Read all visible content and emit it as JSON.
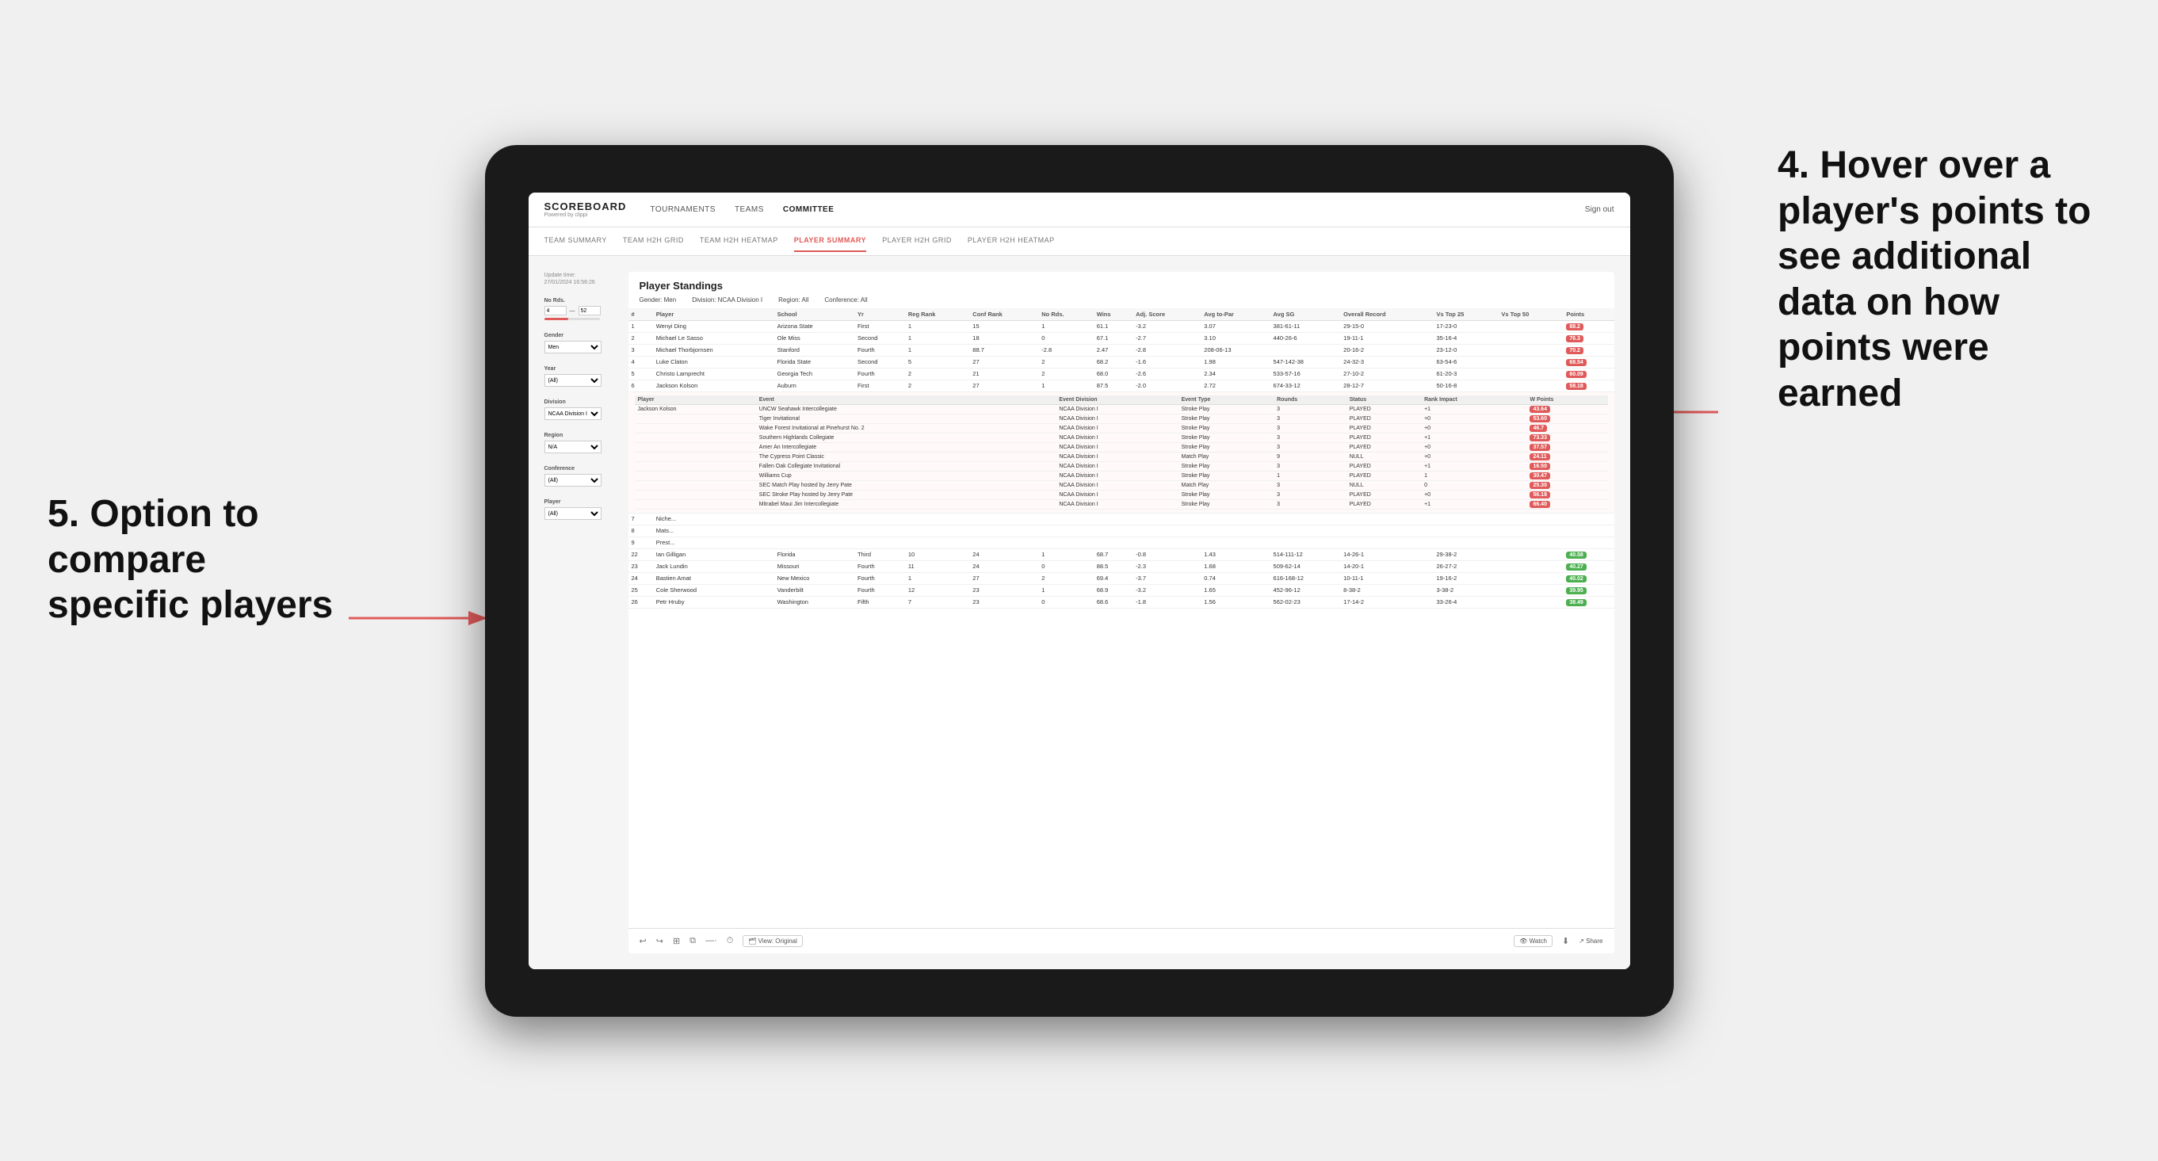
{
  "annotations": {
    "four": {
      "title": "4. Hover over a player's points to see additional data on how points were earned"
    },
    "five": {
      "title": "5. Option to compare specific players"
    }
  },
  "nav": {
    "logo": "SCOREBOARD",
    "logo_sub": "Powered by clippi",
    "links": [
      "TOURNAMENTS",
      "TEAMS",
      "COMMITTEE"
    ],
    "sign_out": "Sign out"
  },
  "sub_nav": {
    "links": [
      "TEAM SUMMARY",
      "TEAM H2H GRID",
      "TEAM H2H HEATMAP",
      "PLAYER SUMMARY",
      "PLAYER H2H GRID",
      "PLAYER H2H HEATMAP"
    ],
    "active": "PLAYER SUMMARY"
  },
  "table": {
    "title": "Player Standings",
    "update_time": "Update time:",
    "update_date": "27/01/2024 16:56:26",
    "filters": {
      "gender": "Gender: Men",
      "division": "Division: NCAA Division I",
      "region": "Region: All",
      "conference": "Conference: All"
    },
    "columns": [
      "#",
      "Player",
      "School",
      "Yr",
      "Reg Rank",
      "Conf Rank",
      "No Rds.",
      "Wins",
      "Adj. Score",
      "Avg to-Par",
      "Avg SG",
      "Overall Record",
      "Vs Top 25",
      "Vs Top 50",
      "Points"
    ],
    "rows": [
      {
        "rank": 1,
        "player": "Wenyi Ding",
        "school": "Arizona State",
        "yr": "First",
        "reg_rank": 1,
        "conf_rank": 15,
        "rds": 1,
        "wins": 61.1,
        "adj_score": -3.2,
        "avg_par": 3.07,
        "avg_sg": "381-61-11",
        "overall": "29-15-0",
        "vs25": "17-23-0",
        "vs50": "",
        "points": "88.2",
        "points_color": "red"
      },
      {
        "rank": 2,
        "player": "Michael Le Sasso",
        "school": "Ole Miss",
        "yr": "Second",
        "reg_rank": 1,
        "conf_rank": 18,
        "rds": 0,
        "wins": 67.1,
        "adj_score": -2.7,
        "avg_par": 3.1,
        "avg_sg": "440-26-6",
        "overall": "19-11-1",
        "vs25": "35-16-4",
        "vs50": "",
        "points": "76.3",
        "points_color": "red"
      },
      {
        "rank": 3,
        "player": "Michael Thorbjornsen",
        "school": "Stanford",
        "yr": "Fourth",
        "reg_rank": 1,
        "conf_rank": 88.7,
        "rds": -2.8,
        "wins": 2.47,
        "adj_score": -2.8,
        "avg_par": "208-06-13",
        "avg_sg": "",
        "overall": "20-16-2",
        "vs25": "23-12-0",
        "vs50": "",
        "points": "70.2",
        "points_color": "red"
      },
      {
        "rank": 4,
        "player": "Luke Claton",
        "school": "Florida State",
        "yr": "Second",
        "reg_rank": 5,
        "conf_rank": 27,
        "rds": 2,
        "wins": 68.2,
        "adj_score": -1.6,
        "avg_par": 1.98,
        "avg_sg": "547-142-38",
        "overall": "24-32-3",
        "vs25": "63-54-6",
        "vs50": "",
        "points": "68.54",
        "points_color": "red"
      },
      {
        "rank": 5,
        "player": "Christo Lamprecht",
        "school": "Georgia Tech",
        "yr": "Fourth",
        "reg_rank": 2,
        "conf_rank": 21,
        "rds": 2,
        "wins": 68.0,
        "adj_score": -2.6,
        "avg_par": 2.34,
        "avg_sg": "533-57-16",
        "overall": "27-10-2",
        "vs25": "61-20-3",
        "vs50": "",
        "points": "60.09",
        "points_color": "red"
      },
      {
        "rank": 6,
        "player": "Jackson Kolson",
        "school": "Auburn",
        "yr": "First",
        "reg_rank": 2,
        "conf_rank": 27,
        "rds": 1,
        "wins": 87.5,
        "adj_score": -2.0,
        "avg_par": 2.72,
        "avg_sg": "674-33-12",
        "overall": "28-12-7",
        "vs25": "50-16-8",
        "vs50": "",
        "points": "58.18",
        "points_color": "red"
      }
    ],
    "expanded_player": "Jackson Kolson",
    "expanded_rows": [
      {
        "event": "UNCW Seahawk Intercollegiate",
        "division": "NCAA Division I",
        "type": "Stroke Play",
        "rounds": 3,
        "status": "PLAYED",
        "rank_impact": "+1",
        "w_points": "43.64"
      },
      {
        "event": "Tiger Invitational",
        "division": "NCAA Division I",
        "type": "Stroke Play",
        "rounds": 3,
        "status": "PLAYED",
        "rank_impact": "+0",
        "w_points": "53.60"
      },
      {
        "event": "Wake Forest Invitational at Pinehurst No. 2",
        "division": "NCAA Division I",
        "type": "Stroke Play",
        "rounds": 3,
        "status": "PLAYED",
        "rank_impact": "+0",
        "w_points": "46.7"
      },
      {
        "event": "Southern Highlands Collegiate",
        "division": "NCAA Division I",
        "type": "Stroke Play",
        "rounds": 3,
        "status": "PLAYED",
        "rank_impact": "+1",
        "w_points": "73.33"
      },
      {
        "event": "Amer An Intercollegiate",
        "division": "NCAA Division I",
        "type": "Stroke Play",
        "rounds": 3,
        "status": "PLAYED",
        "rank_impact": "+0",
        "w_points": "37.57"
      },
      {
        "event": "The Cypress Point Classic",
        "division": "NCAA Division I",
        "type": "Match Play",
        "rounds": 9,
        "status": "NULL",
        "rank_impact": "+0",
        "w_points": "24.11"
      },
      {
        "event": "Fallen Oak Collegiate Invitational",
        "division": "NCAA Division I",
        "type": "Stroke Play",
        "rounds": 3,
        "status": "PLAYED",
        "rank_impact": "+1",
        "w_points": "16.50"
      },
      {
        "event": "Williams Cup",
        "division": "NCAA Division I",
        "type": "Stroke Play",
        "rounds": 1,
        "status": "PLAYED",
        "rank_impact": "1",
        "w_points": "30.47"
      },
      {
        "event": "SEC Match Play hosted by Jerry Pate",
        "division": "NCAA Division I",
        "type": "Match Play",
        "rounds": 3,
        "status": "NULL",
        "rank_impact": "0",
        "w_points": "25.30"
      },
      {
        "event": "SEC Stroke Play hosted by Jerry Pate",
        "division": "NCAA Division I",
        "type": "Stroke Play",
        "rounds": 3,
        "status": "PLAYED",
        "rank_impact": "+0",
        "w_points": "56.18"
      },
      {
        "event": "Mitrabel Maui Jim Intercollegiate",
        "division": "NCAA Division I",
        "type": "Stroke Play",
        "rounds": 3,
        "status": "PLAYED",
        "rank_impact": "+1",
        "w_points": "66.40"
      }
    ],
    "more_rows": [
      {
        "rank": 22,
        "player": "Ian Gilligan",
        "school": "Florida",
        "yr": "Third",
        "reg_rank": 10,
        "conf_rank": 24,
        "rds": 1,
        "wins": 68.7,
        "adj_score": -0.8,
        "avg_par": 1.43,
        "avg_sg": "514-111-12",
        "overall": "14-26-1",
        "vs25": "29-38-2",
        "vs50": "",
        "points": "40.58",
        "points_color": "green"
      },
      {
        "rank": 23,
        "player": "Jack Lundin",
        "school": "Missouri",
        "yr": "Fourth",
        "reg_rank": 11,
        "conf_rank": 24,
        "rds": 0,
        "wins": 88.5,
        "adj_score": -2.3,
        "avg_par": 1.68,
        "avg_sg": "509-62-14",
        "overall": "14-20-1",
        "vs25": "26-27-2",
        "vs50": "",
        "points": "40.27",
        "points_color": "green"
      },
      {
        "rank": 24,
        "player": "Bastien Amat",
        "school": "New Mexico",
        "yr": "Fourth",
        "reg_rank": 1,
        "conf_rank": 27,
        "rds": 2,
        "wins": 69.4,
        "adj_score": -3.7,
        "avg_par": 0.74,
        "avg_sg": "616-168-12",
        "overall": "10-11-1",
        "vs25": "19-16-2",
        "vs50": "",
        "points": "40.02",
        "points_color": "green"
      },
      {
        "rank": 25,
        "player": "Cole Sherwood",
        "school": "Vanderbilt",
        "yr": "Fourth",
        "reg_rank": 12,
        "conf_rank": 23,
        "rds": 1,
        "wins": 68.9,
        "adj_score": -3.2,
        "avg_par": 1.65,
        "avg_sg": "452-96-12",
        "overall": "8-38-2",
        "vs25": "3-38-2",
        "vs50": "",
        "points": "39.95",
        "points_color": "green"
      },
      {
        "rank": 26,
        "player": "Petr Hruby",
        "school": "Washington",
        "yr": "Fifth",
        "reg_rank": 7,
        "conf_rank": 23,
        "rds": 0,
        "wins": 68.6,
        "adj_score": -1.8,
        "avg_par": 1.56,
        "avg_sg": "562-02-23",
        "overall": "17-14-2",
        "vs25": "33-26-4",
        "vs50": "",
        "points": "38.49",
        "points_color": "green"
      }
    ]
  },
  "sidebar": {
    "no_rds_label": "No Rds.",
    "no_rds_min": "4",
    "no_rds_max": "52",
    "gender_label": "Gender",
    "gender_value": "Men",
    "year_label": "Year",
    "year_value": "(All)",
    "division_label": "Division",
    "division_value": "NCAA Division I",
    "region_label": "Region",
    "region_value": "N/A",
    "conference_label": "Conference",
    "conference_value": "(All)",
    "player_label": "Player",
    "player_value": "(All)"
  },
  "bottom_bar": {
    "view_label": "🗂 View: Original",
    "watch_label": "👁 Watch",
    "share_label": "↗ Share"
  }
}
